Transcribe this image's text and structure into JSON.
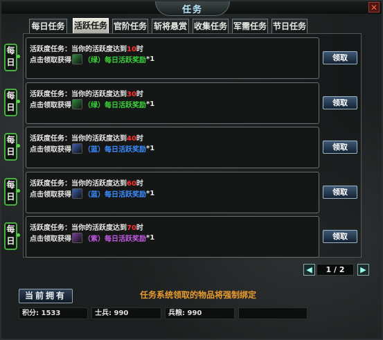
{
  "window": {
    "title": "任务",
    "close_glyph": "✕"
  },
  "tabs": [
    {
      "label": "每日任务",
      "active": false
    },
    {
      "label": "活跃任务",
      "active": true
    },
    {
      "label": "官阶任务",
      "active": false
    },
    {
      "label": "斩将悬赏",
      "active": false
    },
    {
      "label": "收集任务",
      "active": false
    },
    {
      "label": "军需任务",
      "active": false
    },
    {
      "label": "节日任务",
      "active": false
    }
  ],
  "tasks": [
    {
      "badge": "每日",
      "text_before": "活跃度任务：当你的活跃度达到",
      "value": "10",
      "text_after": "时",
      "reward_prefix": "点击领取获得",
      "reward": "（绿）每日活跃奖励",
      "reward_color": "#3bd23b",
      "count": "*1",
      "icon": "green-box-icon",
      "button": "领取"
    },
    {
      "badge": "每日",
      "text_before": "活跃度任务：当你的活跃度达到",
      "value": "30",
      "text_after": "时",
      "reward_prefix": "点击领取获得",
      "reward": "（绿）每日活跃奖励",
      "reward_color": "#3bd23b",
      "count": "*1",
      "icon": "green-box-icon",
      "button": "领取"
    },
    {
      "badge": "每日",
      "text_before": "活跃度任务：当你的活跃度达到",
      "value": "40",
      "text_after": "时",
      "reward_prefix": "点击领取获得",
      "reward": "（蓝）每日活跃奖励",
      "reward_color": "#3a8cff",
      "count": "*1",
      "icon": "blue-box-icon",
      "button": "领取"
    },
    {
      "badge": "每日",
      "text_before": "活跃度任务：当你的活跃度达到",
      "value": "60",
      "text_after": "时",
      "reward_prefix": "点击领取获得",
      "reward": "（蓝）每日活跃奖励",
      "reward_color": "#3a8cff",
      "count": "*1",
      "icon": "blue-box-icon",
      "button": "领取"
    },
    {
      "badge": "每日",
      "text_before": "活跃度任务：当你的活跃度达到",
      "value": "70",
      "text_after": "时",
      "reward_prefix": "点击领取获得",
      "reward": "（紫）每日活跃奖励",
      "reward_color": "#c05ae0",
      "count": "*1",
      "icon": "purple-box-icon",
      "button": "领取"
    }
  ],
  "pager": {
    "prev_glyph": "◀",
    "next_glyph": "▶",
    "label": "1 / 2"
  },
  "footer": {
    "have_button": "当前拥有",
    "notice": "任务系统领取的物品将强制绑定",
    "stats": [
      "积分: 1533",
      "士兵: 990",
      "兵粮: 990",
      ""
    ]
  },
  "colors": {
    "accent": "#e89a2e",
    "highlight_number": "#ff3131",
    "badge_border": "#46b43c"
  }
}
